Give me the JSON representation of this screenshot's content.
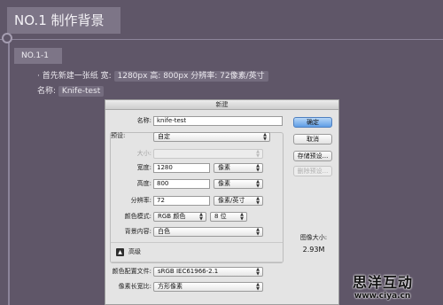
{
  "tutorial": {
    "section_title": "NO.1  制作背景",
    "step_label": "NO.1-1",
    "line1_prefix": "· 首先新建一张纸  宽:",
    "line1_spec": "1280px 高: 800px 分辨率: 72像素/英寸",
    "line2_prefix": "名称:",
    "line2_name": "Knife-test"
  },
  "dialog": {
    "title": "新建",
    "name_label": "名称:",
    "name_value": "knife-test",
    "preset_label": "预设:",
    "preset_value": "自定",
    "size_label": "大小:",
    "size_value": "",
    "width_label": "宽度:",
    "width_value": "1280",
    "width_unit": "像素",
    "height_label": "高度:",
    "height_value": "800",
    "height_unit": "像素",
    "resolution_label": "分辨率:",
    "resolution_value": "72",
    "resolution_unit": "像素/英寸",
    "color_mode_label": "颜色模式:",
    "color_mode_value": "RGB 颜色",
    "bit_depth_value": "8 位",
    "background_label": "背景内容:",
    "background_value": "白色",
    "advanced_label": "高级",
    "color_profile_label": "颜色配置文件:",
    "color_profile_value": "sRGB IEC61966-2.1",
    "pixel_aspect_label": "像素长宽比:",
    "pixel_aspect_value": "方形像素",
    "image_size_label": "图像大小:",
    "image_size_value": "2.93M",
    "buttons": {
      "ok": "确定",
      "cancel": "取消",
      "save_preset": "存储预设...",
      "delete_preset": "删除预设..."
    }
  },
  "watermark": {
    "brand": "思洋互动",
    "url": "www.ciya.cn"
  },
  "icons": {
    "select_arrows": "updown-arrows-icon",
    "expander": "expand-triangle-icon",
    "timeline_node": "circle-node-icon"
  },
  "colors": {
    "background": "#5f5668",
    "accent_button": "#5f9ee6"
  }
}
